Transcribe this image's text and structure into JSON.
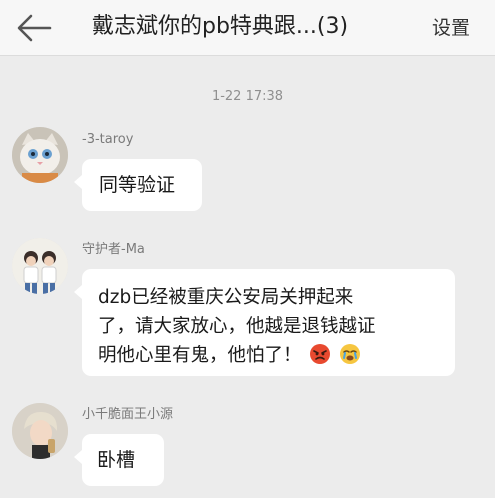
{
  "header": {
    "title": "戴志斌你的pb特典跟...(3)",
    "settings_label": "设置"
  },
  "timestamp": "1-22 17:38",
  "messages": [
    {
      "sender": "-3-taroy",
      "text": "同等验证",
      "avatar_icon": "cat-avatar"
    },
    {
      "sender": "守护者-Ma",
      "lines": [
        "dzb已经被重庆公安局关押起来",
        "了，请大家放心，他越是退钱越证",
        "明他心里有鬼，他怕了！"
      ],
      "emojis": [
        "angry-face-emoji",
        "crying-face-emoji"
      ],
      "avatar_icon": "two-people-avatar"
    },
    {
      "sender": "小千脆面王小源",
      "text": "卧槽",
      "avatar_icon": "person-avatar"
    }
  ],
  "colors": {
    "background": "#ececec",
    "bubble": "#ffffff",
    "titlebar": "#f7f7f7"
  }
}
